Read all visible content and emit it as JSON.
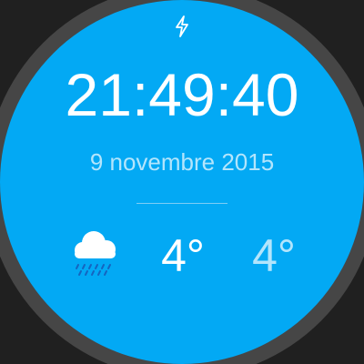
{
  "watchface": {
    "time": "21:49:40",
    "date": "9 novembre 2015",
    "status_icon": "charging-bolt-icon",
    "weather": {
      "icon": "cloud-rain-icon",
      "temp_high": "4°",
      "temp_low": "4°"
    },
    "colors": {
      "face": "#03A9F4",
      "bezel": "#464646",
      "background": "#202020",
      "primary_text": "#FFFFFF",
      "secondary_text": "#B3E5FC"
    }
  }
}
